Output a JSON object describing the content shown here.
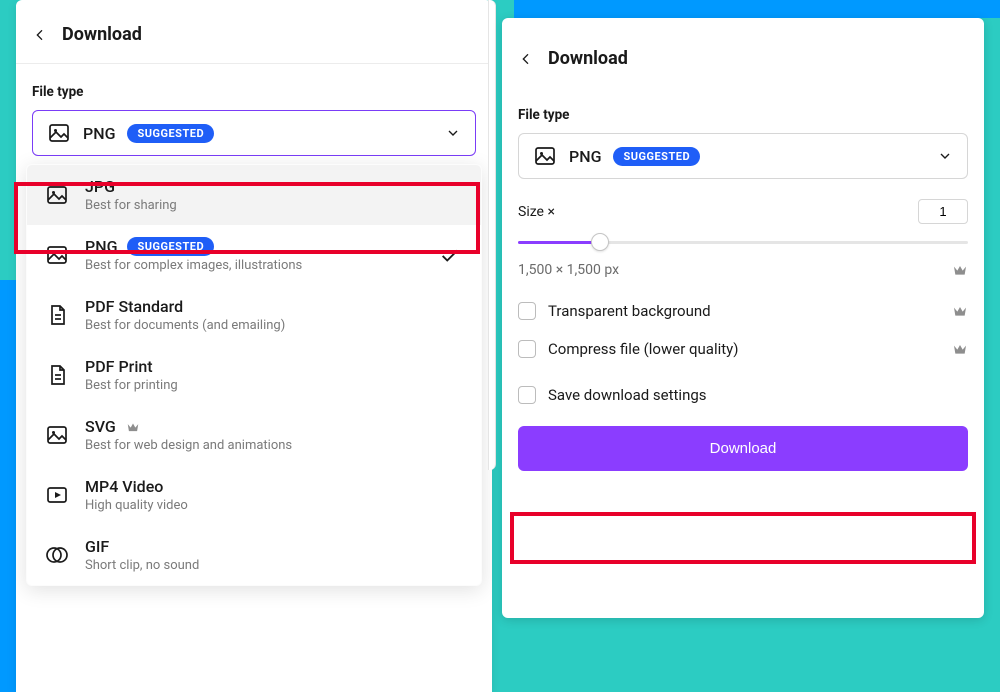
{
  "left": {
    "title": "Download",
    "file_type_label": "File type",
    "selected": {
      "name": "PNG",
      "badge": "SUGGESTED"
    },
    "options": [
      {
        "name": "JPG",
        "sub": "Best for sharing",
        "icon": "image",
        "highlight": true
      },
      {
        "name": "PNG",
        "sub": "Best for complex images, illustrations",
        "icon": "image",
        "badge": "SUGGESTED",
        "checked": true
      },
      {
        "name": "PDF Standard",
        "sub": "Best for documents (and emailing)",
        "icon": "pdf"
      },
      {
        "name": "PDF Print",
        "sub": "Best for printing",
        "icon": "pdf"
      },
      {
        "name": "SVG",
        "sub": "Best for web design and animations",
        "icon": "image",
        "premium": true
      },
      {
        "name": "MP4 Video",
        "sub": "High quality video",
        "icon": "video"
      },
      {
        "name": "GIF",
        "sub": "Short clip, no sound",
        "icon": "gif"
      }
    ]
  },
  "right": {
    "title": "Download",
    "file_type_label": "File type",
    "selected": {
      "name": "PNG",
      "badge": "SUGGESTED"
    },
    "size_label": "Size ×",
    "size_value": "1",
    "dimensions": "1,500 × 1,500 px",
    "opts": {
      "transparent": "Transparent background",
      "compress": "Compress file (lower quality)",
      "save_settings": "Save download settings"
    },
    "button": "Download"
  }
}
